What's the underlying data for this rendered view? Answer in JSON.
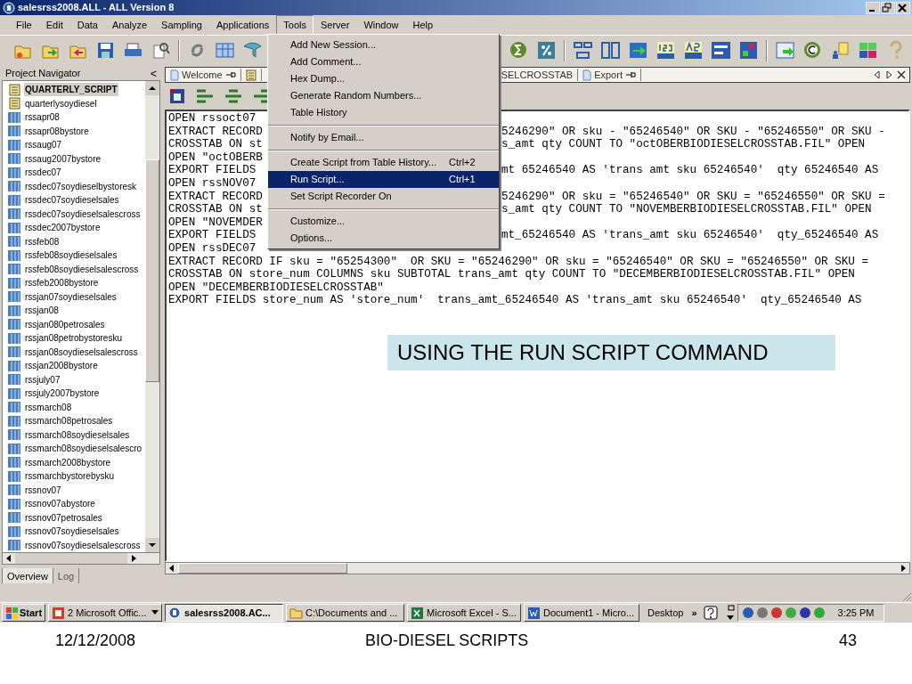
{
  "window": {
    "title": "salesrss2008.ALL - ALL Version 8"
  },
  "menu_bar": [
    {
      "label": "File",
      "selected": false
    },
    {
      "label": "Edit",
      "selected": false
    },
    {
      "label": "Data",
      "selected": false
    },
    {
      "label": "Analyze",
      "selected": false
    },
    {
      "label": "Sampling",
      "selected": false
    },
    {
      "label": "Applications",
      "selected": false
    },
    {
      "label": "Tools",
      "selected": true
    },
    {
      "label": "Server",
      "selected": false
    },
    {
      "label": "Window",
      "selected": false
    },
    {
      "label": "Help",
      "selected": false
    }
  ],
  "tools_menu": [
    {
      "kind": "item",
      "label": "Add New Session...",
      "selected": false
    },
    {
      "kind": "item",
      "label": "Add Comment...",
      "selected": false
    },
    {
      "kind": "item",
      "label": "Hex Dump...",
      "selected": false
    },
    {
      "kind": "item",
      "label": "Generate Random Numbers...",
      "selected": false
    },
    {
      "kind": "item",
      "label": "Table History",
      "selected": false
    },
    {
      "kind": "separator"
    },
    {
      "kind": "item",
      "label": "Notify by Email...",
      "selected": false
    },
    {
      "kind": "separator"
    },
    {
      "kind": "item",
      "label": "Create Script from Table History...",
      "shortcut": "Ctrl+2",
      "selected": false
    },
    {
      "kind": "item",
      "label": "Run Script...",
      "shortcut": "Ctrl+1",
      "selected": true
    },
    {
      "kind": "item",
      "label": "Set Script Recorder On",
      "selected": false
    },
    {
      "kind": "separator"
    },
    {
      "kind": "item",
      "label": "Customize...",
      "selected": false
    },
    {
      "kind": "item",
      "label": "Options...",
      "selected": false
    }
  ],
  "project_navigator": {
    "title": "Project Navigator",
    "collapse": "<",
    "items": [
      {
        "label": "QUARTERLY_SCRIPT",
        "kind": "script",
        "selected": true
      },
      {
        "label": "quarterlysoydiesel",
        "kind": "script",
        "selected": false
      },
      {
        "label": "rssapr08",
        "kind": "table",
        "selected": false
      },
      {
        "label": "rssapr08bystore",
        "kind": "table",
        "selected": false
      },
      {
        "label": "rssaug07",
        "kind": "table",
        "selected": false
      },
      {
        "label": "rssaug2007bystore",
        "kind": "table",
        "selected": false
      },
      {
        "label": "rssdec07",
        "kind": "table",
        "selected": false
      },
      {
        "label": "rssdec07soydieselbystoresk",
        "kind": "table",
        "selected": false
      },
      {
        "label": "rssdec07soydieselsales",
        "kind": "table",
        "selected": false
      },
      {
        "label": "rssdec07soydieselsalescross",
        "kind": "table",
        "selected": false
      },
      {
        "label": "rssdec2007bystore",
        "kind": "table",
        "selected": false
      },
      {
        "label": "rssfeb08",
        "kind": "table",
        "selected": false
      },
      {
        "label": "rssfeb08soydieselsales",
        "kind": "table",
        "selected": false
      },
      {
        "label": "rssfeb08soydieselsalescross",
        "kind": "table",
        "selected": false
      },
      {
        "label": "rssfeb2008bystore",
        "kind": "table",
        "selected": false
      },
      {
        "label": "rssjan07soydieselsales",
        "kind": "table",
        "selected": false
      },
      {
        "label": "rssjan08",
        "kind": "table",
        "selected": false
      },
      {
        "label": "rssjan080petrosales",
        "kind": "table",
        "selected": false
      },
      {
        "label": "rssjan08petrobystoresku",
        "kind": "table",
        "selected": false
      },
      {
        "label": "rssjan08soydieselsalescross",
        "kind": "table",
        "selected": false
      },
      {
        "label": "rssjan2008bystore",
        "kind": "table",
        "selected": false
      },
      {
        "label": "rssjuly07",
        "kind": "table",
        "selected": false
      },
      {
        "label": "rssjuly2007bystore",
        "kind": "table",
        "selected": false
      },
      {
        "label": "rssmarch08",
        "kind": "table",
        "selected": false
      },
      {
        "label": "rssmarch08petrosales",
        "kind": "table",
        "selected": false
      },
      {
        "label": "rssmarch08soydieselsales",
        "kind": "table",
        "selected": false
      },
      {
        "label": "rssmarch08soydieselsalescro",
        "kind": "table",
        "selected": false
      },
      {
        "label": "rssmarch2008bystore",
        "kind": "table",
        "selected": false
      },
      {
        "label": "rssmarchbystorebysku",
        "kind": "table",
        "selected": false
      },
      {
        "label": "rssnov07",
        "kind": "table",
        "selected": false
      },
      {
        "label": "rssnov07abystore",
        "kind": "table",
        "selected": false
      },
      {
        "label": "rssnov07petrosales",
        "kind": "table",
        "selected": false
      },
      {
        "label": "rssnov07soydieselsales",
        "kind": "table",
        "selected": false
      },
      {
        "label": "rssnov07soydieselsalescross",
        "kind": "table",
        "selected": false
      }
    ]
  },
  "panel_tabs": [
    {
      "label": "Overview",
      "selected": true
    },
    {
      "label": "Log",
      "selected": false
    }
  ],
  "editor_tabs": [
    {
      "kind": "document",
      "label": "Welcome",
      "pinned": true
    },
    {
      "kind": "script",
      "pinned": false
    },
    {
      "kind": "clipped",
      "label": "SELCROSSTAB",
      "pinned": false
    },
    {
      "kind": "document",
      "label": "Export",
      "pinned": true
    }
  ],
  "script_lines": [
    {
      "left": "OPEN rssoct07"
    },
    {
      "left": "EXTRACT RECORD",
      "right": "5246290\" OR sku - \"65246540\" OR SKU - \"65246550\" OR SKU -"
    },
    {
      "left": "CROSSTAB ON st",
      "right": "s_amt qty COUNT TO \"octOBERBIODIESELCROSSTAB.FIL\" OPEN"
    },
    {
      "left": "OPEN \"octOBERB"
    },
    {
      "left": "EXPORT FIELDS",
      "right": "mt 65246540 AS 'trans amt sku 65246540'  qty 65246540 AS"
    },
    {
      "left": "OPEN rssNOV07"
    },
    {
      "left": "EXTRACT RECORD",
      "right": "5246290\" OR sku = \"65246540\" OR SKU = \"65246550\" OR SKU ="
    },
    {
      "left": "CROSSTAB ON st",
      "right": "s_amt qty COUNT TO \"NOVEMBERBIODIESELCROSSTAB.FIL\" OPEN"
    },
    {
      "left": "OPEN \"NOVEMDER"
    },
    {
      "left": "EXPORT FIELDS",
      "right": "mt_65246540 AS 'trans_amt sku 65246540'  qty_65246540 AS"
    },
    {
      "text": "OPEN rssDEC07"
    },
    {
      "text": "EXTRACT RECORD IF sku = \"65254300\"  OR SKU = \"65246290\" OR sku = \"65246540\" OR SKU = \"65246550\" OR SKU ="
    },
    {
      "text": "CROSSTAB ON store_num COLUMNS sku SUBTOTAL trans_amt qty COUNT TO \"DECEMBERBIODIESELCROSSTAB.FIL\" OPEN"
    },
    {
      "text": "OPEN \"DECEMBERBIODIESELCROSSTAB\""
    },
    {
      "text": "EXPORT FIELDS store_num AS 'store_num'  trans_amt_65246540 AS 'trans_amt sku 65246540'  qty_65246540 AS"
    }
  ],
  "callout": {
    "text": "USING THE RUN SCRIPT COMMAND"
  },
  "taskbar": {
    "start": "Start",
    "buttons": [
      {
        "kind": "powerpoint",
        "label": "2 Microsoft Offic...",
        "grouped": true,
        "selected": false
      },
      {
        "kind": "app",
        "label": "salesrss2008.AC...",
        "grouped": false,
        "selected": true
      },
      {
        "kind": "folder",
        "label": "C:\\Documents and ...",
        "grouped": false,
        "selected": false
      },
      {
        "kind": "excel",
        "label": "Microsoft Excel - S...",
        "grouped": false,
        "selected": false
      },
      {
        "kind": "word",
        "label": "Document1 - Micro...",
        "grouped": false,
        "selected": false
      }
    ],
    "desktop": "Desktop",
    "chevron": "»",
    "clock": "3:25 PM"
  },
  "slide_footer": {
    "date": "12/12/2008",
    "title": "BIO-DIESEL SCRIPTS",
    "page": "43"
  }
}
